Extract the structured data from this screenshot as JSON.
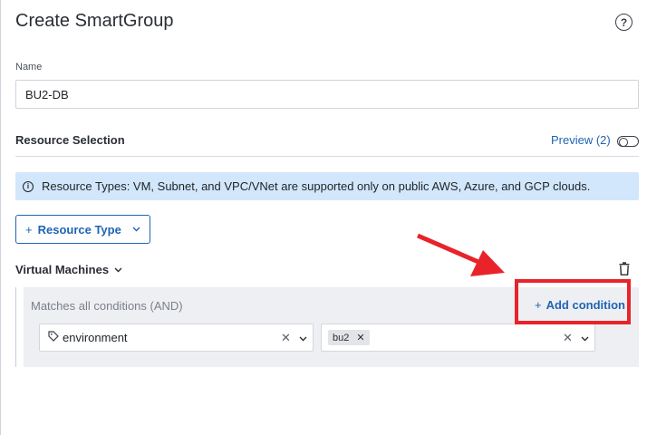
{
  "header": {
    "title": "Create SmartGroup",
    "help_icon": "question-circle-icon",
    "help_glyph": "?"
  },
  "name_field": {
    "label": "Name",
    "value": "BU2-DB"
  },
  "resource_selection": {
    "title": "Resource Selection",
    "preview_label": "Preview (2)",
    "preview_toggle_on": false
  },
  "info_banner": {
    "icon_glyph": "i",
    "text": "Resource Types: VM, Subnet, and VPC/VNet are supported only on public AWS, Azure, and GCP clouds."
  },
  "resource_type_button": {
    "plus": "+",
    "label": "Resource Type",
    "chevron": "⌄"
  },
  "virtual_machines": {
    "title": "Virtual Machines",
    "chevron": "⌄",
    "trash_icon": "trash-icon",
    "matches_text": "Matches all conditions (AND)",
    "add_condition_plus": "+",
    "add_condition_label": "Add condition",
    "condition": {
      "tag_icon": "tag-icon",
      "tag_glyph": "⌂",
      "key": "environment",
      "values": [
        "bu2"
      ],
      "chip_remove": "✕",
      "clear": "✕",
      "chevron": "⌄"
    }
  },
  "colors": {
    "accent": "#1f64b4",
    "banner_bg": "#d2e7fb",
    "highlight": "#e8232a",
    "panel_bg": "#eeeff2"
  }
}
